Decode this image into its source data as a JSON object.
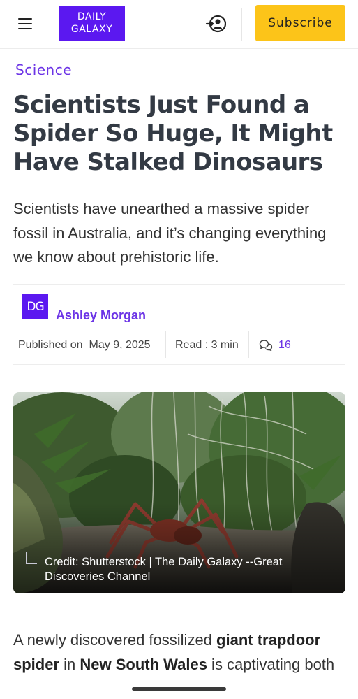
{
  "header": {
    "logo_line1": "DAILY",
    "logo_line2": "GALAXY",
    "subscribe_label": "Subscribe",
    "menu_icon": "hamburger-menu-icon",
    "login_icon": "user-login-icon"
  },
  "article": {
    "category": "Science",
    "title": "Scientists Just Found a Spider So Huge, It Might Have Stalked Dinosaurs",
    "dek": "Scientists have unearthed a massive spider fossil in Australia, and it’s changing everything we know about prehistoric life.",
    "author": {
      "avatar_initials": "DG",
      "name": "Ashley Morgan"
    },
    "meta": {
      "published_label": "Published on",
      "published_date": "May 9, 2025",
      "read_time": "Read : 3 min",
      "comments_count": "16",
      "comments_icon": "comment-bubbles-icon"
    },
    "hero": {
      "caption": "Credit: Shutterstock | The Daily Galaxy --Great Discoveries Channel"
    },
    "body": {
      "p1_a": "A newly discovered fossilized ",
      "p1_b": "giant trapdoor spider",
      "p1_c": " in ",
      "p1_d": "New South Wales",
      "p1_e": " is captivating both"
    }
  },
  "colors": {
    "brand_purple": "#5b18f0",
    "accent_purple": "#6c34e6",
    "subscribe_yellow": "#fcc419",
    "title_color": "#333a44"
  }
}
